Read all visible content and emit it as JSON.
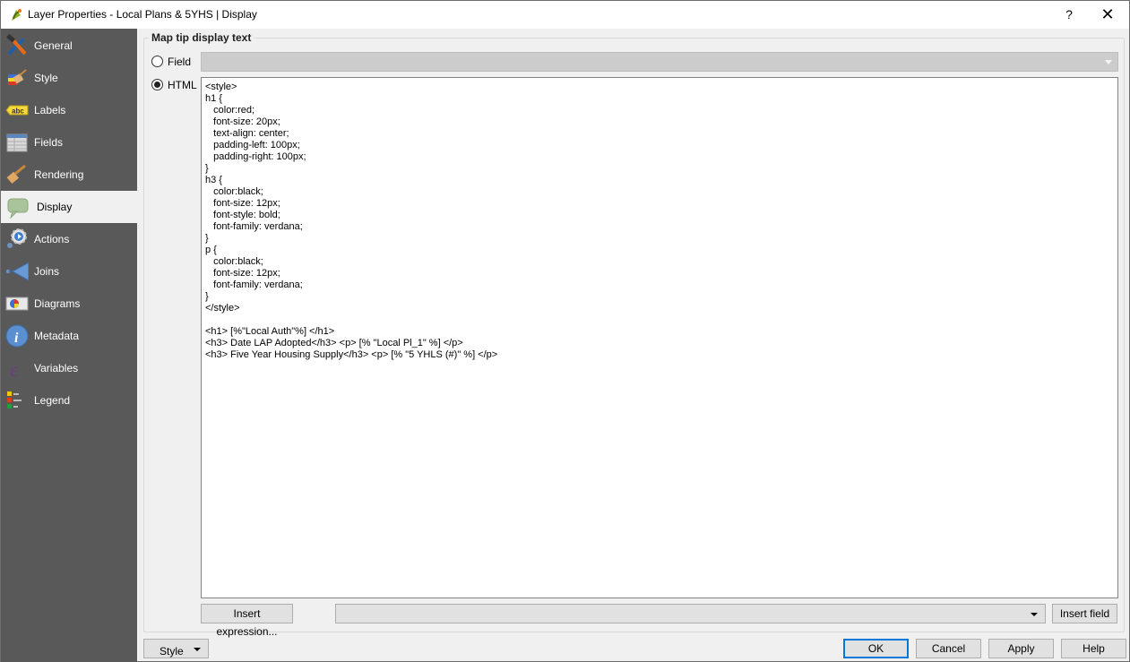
{
  "window": {
    "title": "Layer Properties - Local Plans & 5YHS | Display",
    "help_label": "?",
    "close_label": "✕"
  },
  "sidebar": {
    "active": "Display",
    "items": [
      {
        "label": "General",
        "icon": "tools-icon"
      },
      {
        "label": "Style",
        "icon": "paintbrush-icon"
      },
      {
        "label": "Labels",
        "icon": "abc-label-icon"
      },
      {
        "label": "Fields",
        "icon": "table-icon"
      },
      {
        "label": "Rendering",
        "icon": "brush-icon"
      },
      {
        "label": "Display",
        "icon": "speech-bubble-icon"
      },
      {
        "label": "Actions",
        "icon": "gear-play-icon"
      },
      {
        "label": "Joins",
        "icon": "join-arrow-icon"
      },
      {
        "label": "Diagrams",
        "icon": "pie-chart-icon"
      },
      {
        "label": "Metadata",
        "icon": "info-icon"
      },
      {
        "label": "Variables",
        "icon": "epsilon-icon"
      },
      {
        "label": "Legend",
        "icon": "legend-icon"
      }
    ]
  },
  "maptip": {
    "group_title": "Map tip display text",
    "field_radio_label": "Field",
    "html_radio_label": "HTML",
    "selected_mode": "HTML",
    "field_value": "",
    "html_lines": [
      "<style>",
      "h1 {",
      "   color:red;",
      "   font-size: 20px;",
      "   text-align: center;",
      "   padding-left: 100px;",
      "   padding-right: 100px;",
      "}",
      "h3 {",
      "   color:black;",
      "   font-size: 12px;",
      "   font-style: bold;",
      "   font-family: verdana;",
      "}",
      "p {",
      "   color:black;",
      "   font-size: 12px;",
      "   font-family: verdana;",
      "}",
      "</style>",
      "",
      "<h1> [%\"Local Auth\"%] </h1>",
      "<h3> Date LAP Adopted</h3> <p> [% \"Local Pl_1\" %] </p>",
      "<h3> Five Year Housing Supply</h3> <p> [% \"5 YHLS (#)\" %] </p>"
    ],
    "insert_expression_label": "Insert expression...",
    "field_select_value": "",
    "insert_field_label": "Insert field"
  },
  "footer": {
    "style_label": "Style",
    "ok_label": "OK",
    "cancel_label": "Cancel",
    "apply_label": "Apply",
    "help_label": "Help"
  },
  "colors": {
    "sidebar_bg": "#595959",
    "accent": "#0078d7"
  }
}
